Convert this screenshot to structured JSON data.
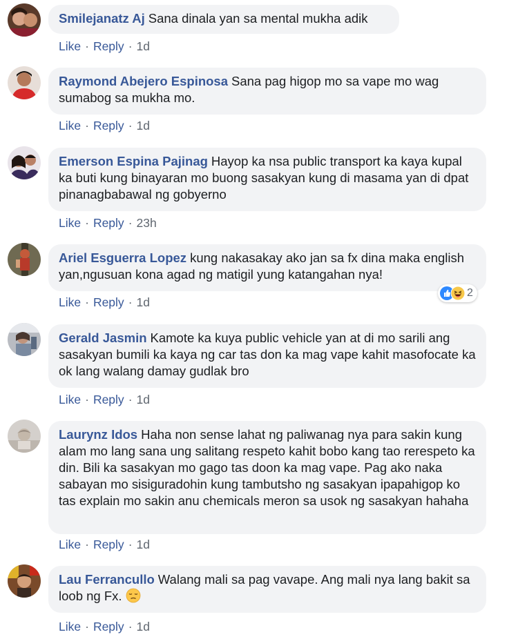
{
  "comments": [
    {
      "author": "Smilejanatz Aj",
      "text": "Sana dinala yan sa mental mukha adik",
      "like": "Like",
      "reply": "Reply",
      "time": "1d"
    },
    {
      "author": "Raymond Abejero Espinosa",
      "text": "Sana pag higop mo sa vape mo wag sumabog sa mukha mo.",
      "like": "Like",
      "reply": "Reply",
      "time": "1d"
    },
    {
      "author": "Emerson Espina Pajinag",
      "text": "Hayop ka nsa public transport ka kaya kupal ka buti kung binayaran mo buong sasakyan kung di masama yan di dpat pinanagbabawal ng gobyerno",
      "like": "Like",
      "reply": "Reply",
      "time": "23h"
    },
    {
      "author": "Ariel Esguerra Lopez",
      "text": "kung nakasakay ako jan sa fx dina maka english yan,ngusuan kona agad ng matigil yung katangahan nya!",
      "like": "Like",
      "reply": "Reply",
      "time": "1d",
      "reaction_count": "2"
    },
    {
      "author": "Gerald Jasmin",
      "text": "Kamote ka kuya public vehicle yan at di mo sarili ang sasakyan bumili ka kaya ng car tas don ka mag vape kahit masofocate ka ok lang walang damay gudlak bro",
      "like": "Like",
      "reply": "Reply",
      "time": "1d"
    },
    {
      "author": "Laurynz Idos",
      "text": "Haha non sense lahat ng paliwanag nya para sakin kung alam mo lang sana ung salitang respeto kahit bobo kang tao rerespeto ka din. Bili ka sasakyan mo gago tas doon ka mag vape. Pag ako naka sabayan mo sisiguradohin kung tambutsho ng sasakyan ipapahigop ko tas explain mo sakin anu chemicals meron sa usok ng sasakyan hahaha",
      "like": "Like",
      "reply": "Reply",
      "time": "1d"
    },
    {
      "author": "Lau Ferrancullo",
      "text": "Walang mali sa pag vavape. Ang mali nya lang bakit sa loob ng Fx.",
      "like": "Like",
      "reply": "Reply",
      "time": "1d"
    }
  ],
  "separator": "·",
  "colors": {
    "name": "#385898",
    "bubble": "#f2f3f5",
    "meta": "#606770",
    "text": "#1c1e21"
  }
}
